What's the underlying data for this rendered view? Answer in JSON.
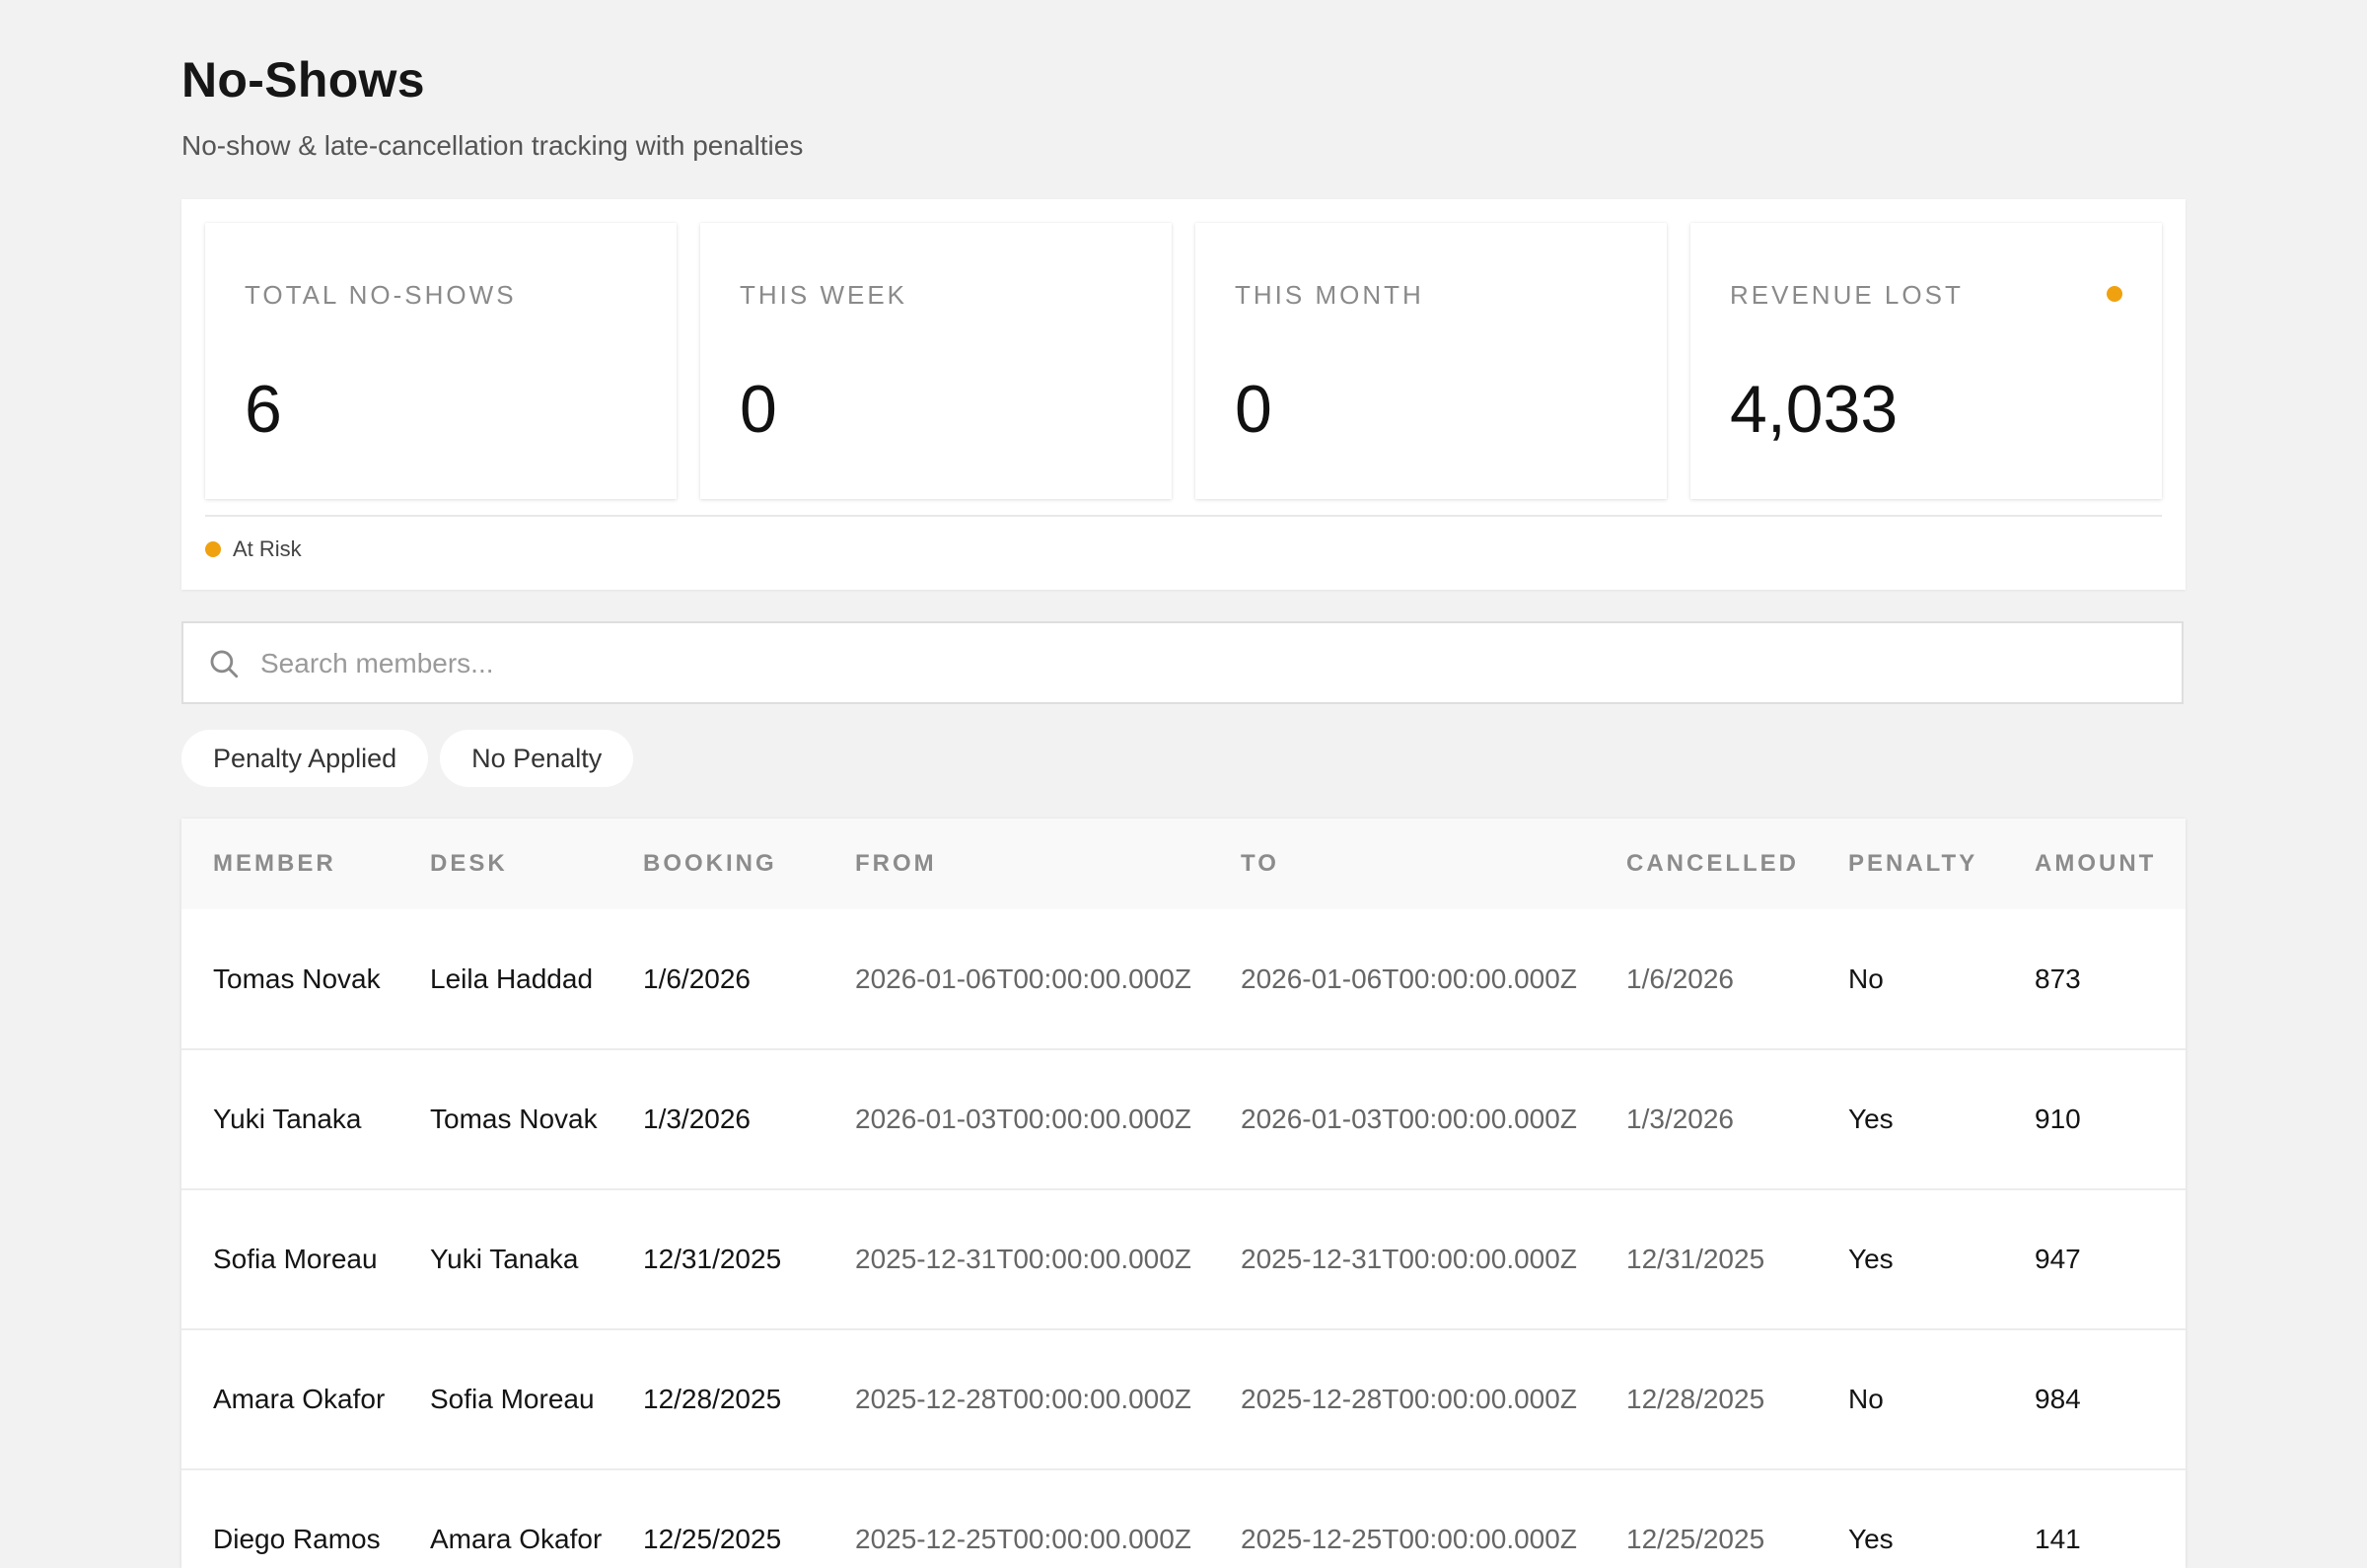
{
  "header": {
    "title": "No-Shows",
    "subtitle": "No-show & late-cancellation tracking with penalties"
  },
  "stats": [
    {
      "label": "TOTAL NO-SHOWS",
      "value": "6",
      "alert": false
    },
    {
      "label": "THIS WEEK",
      "value": "0",
      "alert": false
    },
    {
      "label": "THIS MONTH",
      "value": "0",
      "alert": false
    },
    {
      "label": "REVENUE LOST",
      "value": "4,033",
      "alert": true
    }
  ],
  "legend": {
    "label": "At Risk",
    "color": "#f0a10f"
  },
  "search": {
    "placeholder": "Search members..."
  },
  "filters": [
    {
      "label": "Penalty Applied"
    },
    {
      "label": "No Penalty"
    }
  ],
  "table": {
    "columns": [
      "MEMBER",
      "DESK",
      "BOOKING",
      "FROM",
      "TO",
      "CANCELLED",
      "PENALTY",
      "AMOUNT"
    ],
    "rows": [
      {
        "member": "Tomas Novak",
        "desk": "Leila Haddad",
        "booking": "1/6/2026",
        "from": "2026-01-06T00:00:00.000Z",
        "to": "2026-01-06T00:00:00.000Z",
        "cancelled": "1/6/2026",
        "penalty": "No",
        "amount": "873"
      },
      {
        "member": "Yuki Tanaka",
        "desk": "Tomas Novak",
        "booking": "1/3/2026",
        "from": "2026-01-03T00:00:00.000Z",
        "to": "2026-01-03T00:00:00.000Z",
        "cancelled": "1/3/2026",
        "penalty": "Yes",
        "amount": "910"
      },
      {
        "member": "Sofia Moreau",
        "desk": "Yuki Tanaka",
        "booking": "12/31/2025",
        "from": "2025-12-31T00:00:00.000Z",
        "to": "2025-12-31T00:00:00.000Z",
        "cancelled": "12/31/2025",
        "penalty": "Yes",
        "amount": "947"
      },
      {
        "member": "Amara Okafor",
        "desk": "Sofia Moreau",
        "booking": "12/28/2025",
        "from": "2025-12-28T00:00:00.000Z",
        "to": "2025-12-28T00:00:00.000Z",
        "cancelled": "12/28/2025",
        "penalty": "No",
        "amount": "984"
      },
      {
        "member": "Diego Ramos",
        "desk": "Amara Okafor",
        "booking": "12/25/2025",
        "from": "2025-12-25T00:00:00.000Z",
        "to": "2025-12-25T00:00:00.000Z",
        "cancelled": "12/25/2025",
        "penalty": "Yes",
        "amount": "141"
      }
    ]
  },
  "colors": {
    "accent": "#f0a10f",
    "background": "#f2f2f2"
  }
}
